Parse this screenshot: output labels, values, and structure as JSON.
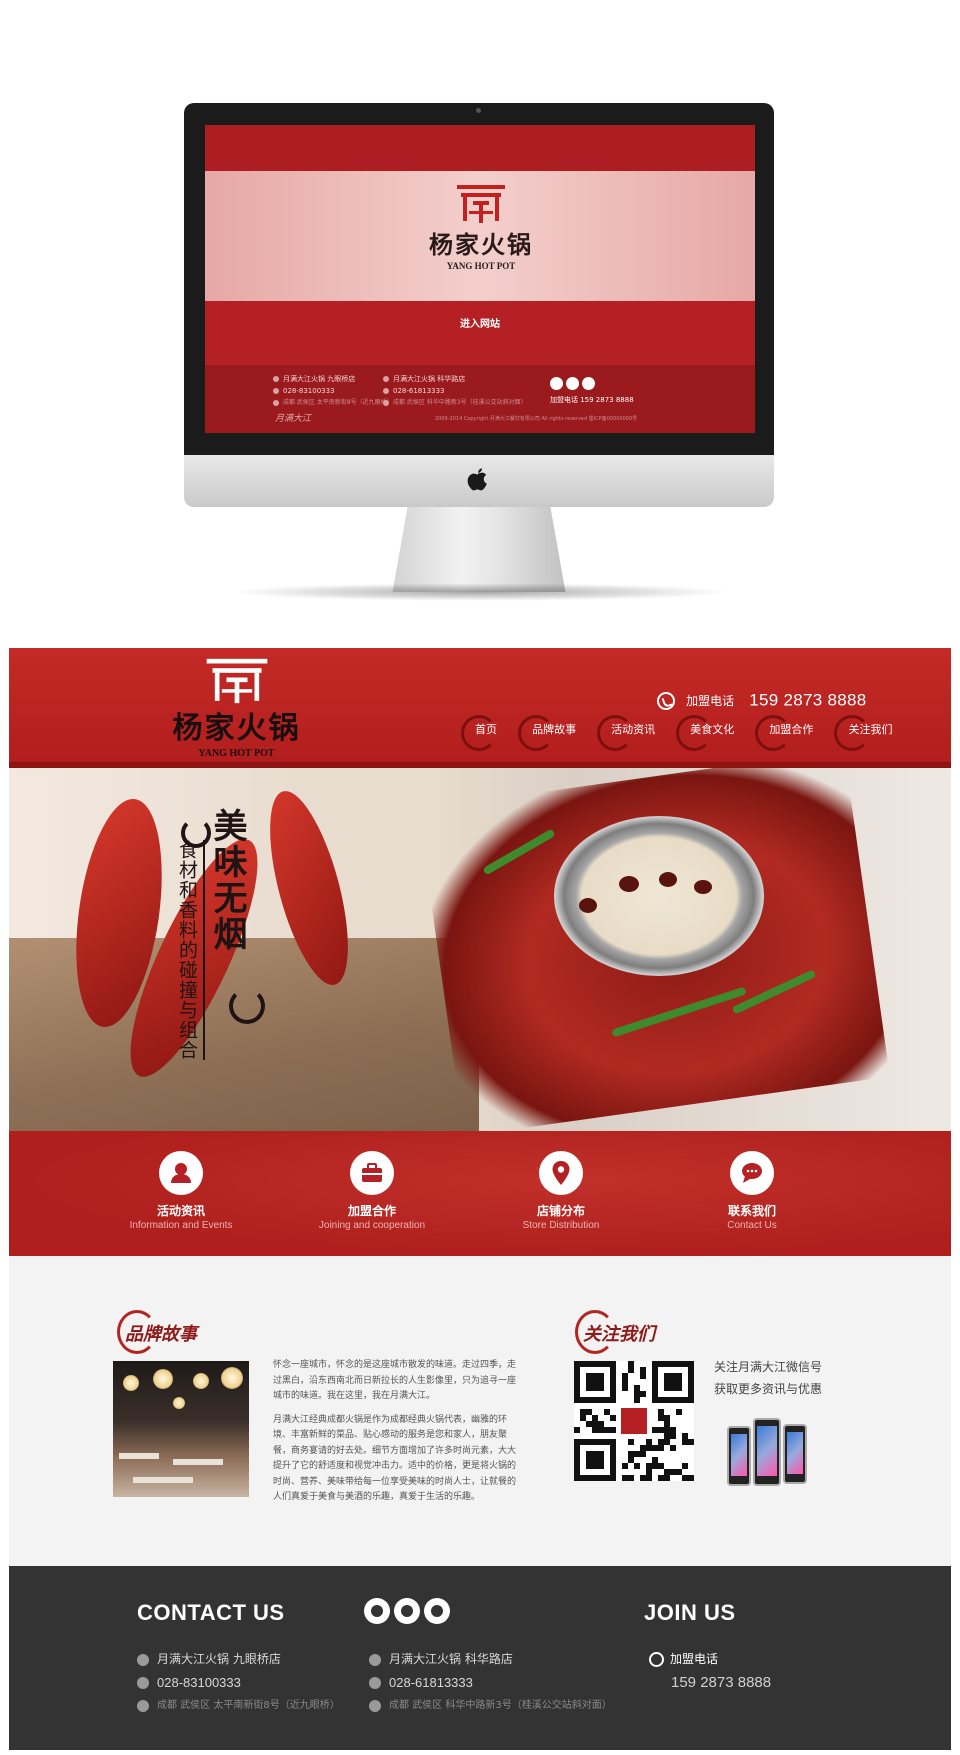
{
  "mockup": {
    "logo_cn": "杨家火锅",
    "logo_en": "YANG HOT POT",
    "enter_button": "进入网站",
    "col1": [
      "月满大江火锅 九眼桥店",
      "028-83100333",
      "成都 武侯区 太平南新街8号（近九眼桥）"
    ],
    "col2": [
      "月满大江火锅 科华路店",
      "028-61813333",
      "成都 武侯区 科华中路新3号（桂溪公交站斜对面）"
    ],
    "phone_line": "加盟电话    159 2873 8888",
    "copyright": "2009-2014 Copyright 月满大江餐饮有限公司  All rights reserved  蜀ICP备00000000号",
    "signature": "月满大江"
  },
  "header": {
    "logo_cn": "杨家火锅",
    "logo_en": "YANG HOT POT",
    "phone_label": "加盟电话",
    "phone_number": "159 2873 8888"
  },
  "nav": [
    "首页",
    "品牌故事",
    "活动资讯",
    "美食文化",
    "加盟合作",
    "关注我们"
  ],
  "hero": {
    "title": "美味无烟",
    "subtitle": "食材和香料的碰撞与组合"
  },
  "features": [
    {
      "title": "活动资讯",
      "en": "Information and Events",
      "icon": "user-icon"
    },
    {
      "title": "加盟合作",
      "en": "Joining and cooperation",
      "icon": "briefcase-icon"
    },
    {
      "title": "店铺分布",
      "en": "Store Distribution",
      "icon": "location-pin-icon"
    },
    {
      "title": "联系我们",
      "en": "Contact Us",
      "icon": "chat-bubble-icon"
    }
  ],
  "story": {
    "heading": "品牌故事",
    "para1": "怀念一座城市，怀念的是这座城市散发的味道。走过四季，走过黑白，沿东西南北而日新拉长的人生影像里，只为追寻一座城市的味道。我在这里，我在月满大江。",
    "para2": "月满大江经典成都火锅是作为成都经典火锅代表，幽雅的环境、丰富新鲜的菜品、贴心感动的服务是您和家人，朋友聚餐，商务宴请的好去处。细节方面增加了许多时尚元素，大大提升了它的舒适度和视觉冲击力。适中的价格，更是将火锅的时尚、营养、美味带给每一位享受美味的时尚人士，让就餐的人们真爱于美食与美酒的乐趣，真爱于生活的乐趣。"
  },
  "follow": {
    "heading": "关注我们",
    "line1": "关注月满大江微信号",
    "line2": "获取更多资讯与优惠"
  },
  "footer": {
    "contact_heading": "CONTACT US",
    "join_heading": "JOIN US",
    "store1": {
      "name": "月满大江火锅 九眼桥店",
      "phone": "028-83100333",
      "address": "成都 武侯区 太平南新街8号（近九眼桥）"
    },
    "store2": {
      "name": "月满大江火锅 科华路店",
      "phone": "028-61813333",
      "address": "成都 武侯区 科华中路新3号（桂溪公交站斜对面）"
    },
    "join_label": "加盟电话",
    "join_phone": "159 2873 8888"
  },
  "colors": {
    "brand_red": "#b42024",
    "dark_footer": "#333333"
  }
}
